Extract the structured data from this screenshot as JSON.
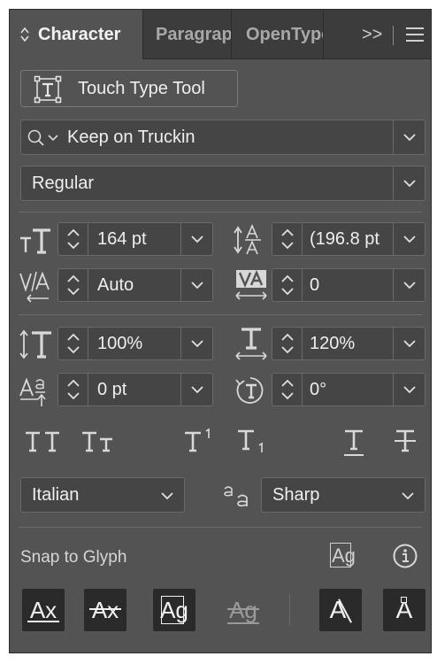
{
  "tabs": [
    {
      "label": "Character"
    },
    {
      "label": "Paragraph"
    },
    {
      "label": "OpenType"
    }
  ],
  "tab_overflow": ">>",
  "touch_type_tool": {
    "label": "Touch Type Tool"
  },
  "font_family": {
    "value": "Keep on Truckin"
  },
  "font_style": {
    "value": "Regular"
  },
  "font_size": {
    "value": "164 pt"
  },
  "leading": {
    "value": "(196.8 pt"
  },
  "kerning": {
    "value": "Auto"
  },
  "tracking": {
    "value": "0"
  },
  "vertical_scale": {
    "value": "100%"
  },
  "horizontal_scale": {
    "value": "120%"
  },
  "baseline_shift": {
    "value": "0 pt"
  },
  "character_rotation": {
    "value": "0°"
  },
  "language": {
    "value": "Italian"
  },
  "anti_aliasing": {
    "value": "Sharp"
  },
  "snap_to_glyph": {
    "label": "Snap to Glyph"
  },
  "glyph_icons": {
    "ax": "Ax",
    "ag": "Ag",
    "a_mark": "A"
  },
  "colors": {
    "panel": "#535353",
    "field": "#454545",
    "tabbar": "#3c3c3c",
    "text": "#efefef",
    "dark_button": "#2a2a2a"
  }
}
